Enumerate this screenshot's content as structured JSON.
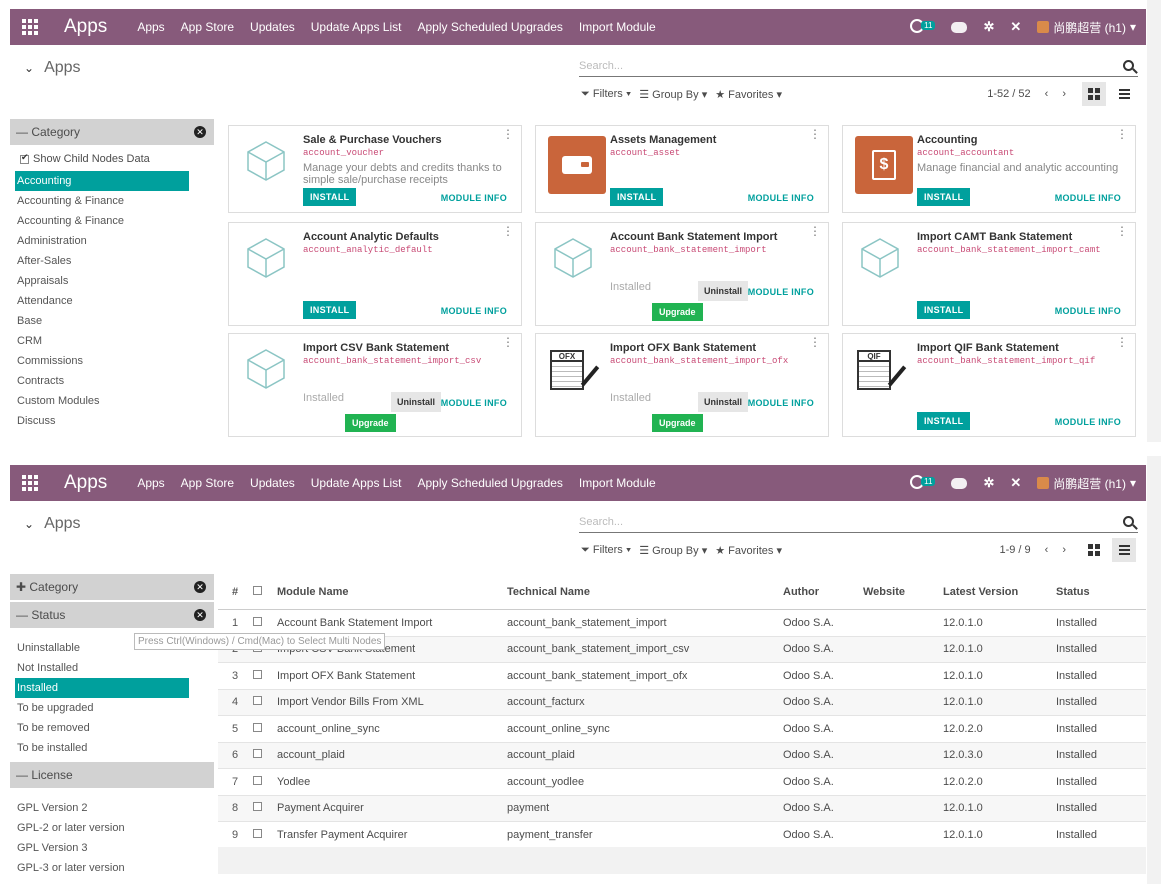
{
  "colors": {
    "navbar": "#875a7b",
    "accent": "#00a09d",
    "upgrade": "#21b352",
    "tech_name": "#c84a75"
  },
  "nav": {
    "brand": "Apps",
    "menu": [
      "Apps",
      "App Store",
      "Updates",
      "Update Apps List",
      "Apply Scheduled Upgrades",
      "Import Module"
    ],
    "activity_badge": "11",
    "user": "尚鹏超营 (h1)"
  },
  "panel1": {
    "breadcrumb": "Apps",
    "search_placeholder": "Search...",
    "filters": "Filters",
    "group_by": "Group By",
    "favorites": "Favorites",
    "pager": "1-52 / 52",
    "sidebar": {
      "category_header": "Category",
      "show_child": "Show Child Nodes Data",
      "items": [
        "Accounting",
        "Accounting & Finance",
        "Accounting & Finance",
        "Administration",
        "After-Sales",
        "Appraisals",
        "Attendance",
        "Base",
        "CRM",
        "Commissions",
        "Contracts",
        "Custom Modules",
        "Discuss"
      ]
    },
    "cards": [
      {
        "title": "Sale & Purchase Vouchers",
        "tech": "account_voucher",
        "desc": "Manage your debts and credits thanks to simple sale/purchase receipts",
        "icon": "cube-icon",
        "state": "install"
      },
      {
        "title": "Assets Management",
        "tech": "account_asset",
        "desc": "",
        "icon": "wallet-icon",
        "state": "install"
      },
      {
        "title": "Accounting",
        "tech": "account_accountant",
        "desc": "Manage financial and analytic accounting",
        "icon": "invoice-icon",
        "state": "install"
      },
      {
        "title": "Account Analytic Defaults",
        "tech": "account_analytic_default",
        "desc": "",
        "icon": "cube-icon",
        "state": "install"
      },
      {
        "title": "Account Bank Statement Import",
        "tech": "account_bank_statement_import",
        "desc": "",
        "icon": "cube-icon",
        "state": "installed"
      },
      {
        "title": "Import CAMT Bank Statement",
        "tech": "account_bank_statement_import_camt",
        "desc": "",
        "icon": "cube-icon",
        "state": "install"
      },
      {
        "title": "Import CSV Bank Statement",
        "tech": "account_bank_statement_import_csv",
        "desc": "",
        "icon": "cube-icon",
        "state": "installed"
      },
      {
        "title": "Import OFX Bank Statement",
        "tech": "account_bank_statement_import_ofx",
        "desc": "",
        "icon": "ofx-icon",
        "state": "installed"
      },
      {
        "title": "Import QIF Bank Statement",
        "tech": "account_bank_statement_import_qif",
        "desc": "",
        "icon": "qif-icon",
        "state": "install"
      }
    ],
    "labels": {
      "install": "INSTALL",
      "module_info": "MODULE INFO",
      "installed": "Installed",
      "uninstall": "Uninstall",
      "upgrade": "Upgrade"
    }
  },
  "panel2": {
    "breadcrumb": "Apps",
    "search_placeholder": "Search...",
    "filters": "Filters",
    "group_by": "Group By",
    "favorites": "Favorites",
    "pager": "1-9 / 9",
    "sidebar": {
      "category_header": "Category",
      "status_header": "Status",
      "status_items": [
        "Uninstallable",
        "Not Installed",
        "Installed",
        "To be upgraded",
        "To be removed",
        "To be installed"
      ],
      "license_header": "License",
      "license_items": [
        "GPL Version 2",
        "GPL-2 or later version",
        "GPL Version 3",
        "GPL-3 or later version"
      ]
    },
    "tooltip": "Press Ctrl(Windows) / Cmd(Mac) to Select Multi Nodes",
    "columns": [
      "#",
      "Module Name",
      "Technical Name",
      "Author",
      "Website",
      "Latest Version",
      "Status"
    ],
    "rows": [
      {
        "n": "1",
        "name": "Account Bank Statement Import",
        "tech": "account_bank_statement_import",
        "author": "Odoo S.A.",
        "website": "",
        "version": "12.0.1.0",
        "status": "Installed"
      },
      {
        "n": "2",
        "name": "Import CSV Bank Statement",
        "tech": "account_bank_statement_import_csv",
        "author": "Odoo S.A.",
        "website": "",
        "version": "12.0.1.0",
        "status": "Installed"
      },
      {
        "n": "3",
        "name": "Import OFX Bank Statement",
        "tech": "account_bank_statement_import_ofx",
        "author": "Odoo S.A.",
        "website": "",
        "version": "12.0.1.0",
        "status": "Installed"
      },
      {
        "n": "4",
        "name": "Import Vendor Bills From XML",
        "tech": "account_facturx",
        "author": "Odoo S.A.",
        "website": "",
        "version": "12.0.1.0",
        "status": "Installed"
      },
      {
        "n": "5",
        "name": "account_online_sync",
        "tech": "account_online_sync",
        "author": "Odoo S.A.",
        "website": "",
        "version": "12.0.2.0",
        "status": "Installed"
      },
      {
        "n": "6",
        "name": "account_plaid",
        "tech": "account_plaid",
        "author": "Odoo S.A.",
        "website": "",
        "version": "12.0.3.0",
        "status": "Installed"
      },
      {
        "n": "7",
        "name": "Yodlee",
        "tech": "account_yodlee",
        "author": "Odoo S.A.",
        "website": "",
        "version": "12.0.2.0",
        "status": "Installed"
      },
      {
        "n": "8",
        "name": "Payment Acquirer",
        "tech": "payment",
        "author": "Odoo S.A.",
        "website": "",
        "version": "12.0.1.0",
        "status": "Installed"
      },
      {
        "n": "9",
        "name": "Transfer Payment Acquirer",
        "tech": "payment_transfer",
        "author": "Odoo S.A.",
        "website": "",
        "version": "12.0.1.0",
        "status": "Installed"
      }
    ]
  }
}
